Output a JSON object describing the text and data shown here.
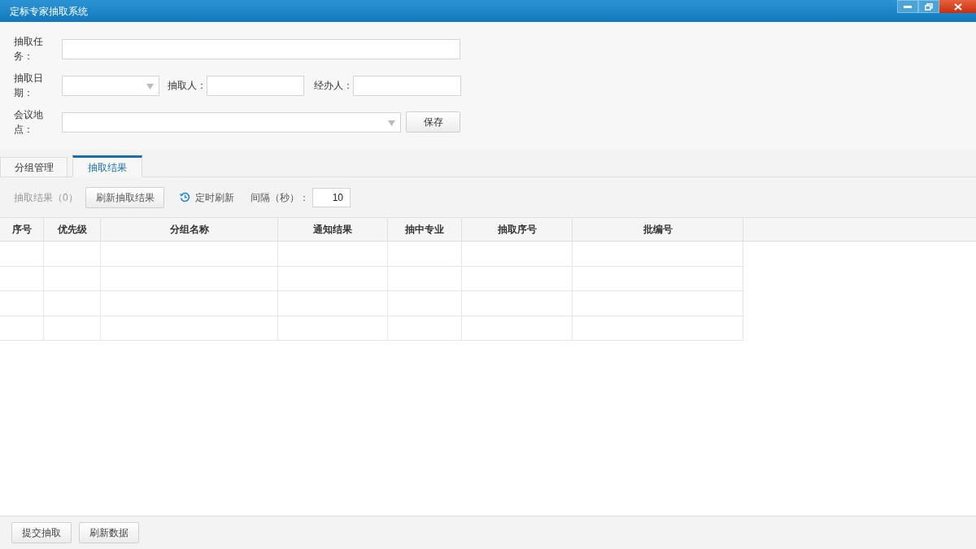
{
  "window": {
    "title": "定标专家抽取系统"
  },
  "form": {
    "task_label": "抽取任务：",
    "date_label": "抽取日期：",
    "drawer_label": "抽取人：",
    "handler_label": "经办人：",
    "location_label": "会议地点：",
    "save_button": "保存"
  },
  "tabs": [
    {
      "label": "分组管理",
      "selected": false
    },
    {
      "label": "抽取结果",
      "selected": true
    }
  ],
  "toolbar": {
    "result_count": "抽取结果（0）",
    "refresh_button": "刷新抽取结果",
    "timer_label": "定时刷新",
    "interval_label": "间隔（秒）：",
    "interval_value": "10"
  },
  "table": {
    "columns": [
      "序号",
      "优先级",
      "分组名称",
      "通知结果",
      "抽中专业",
      "抽取序号",
      "批编号"
    ]
  },
  "footer_buttons": [
    "提交抽取",
    "刷新数据"
  ]
}
